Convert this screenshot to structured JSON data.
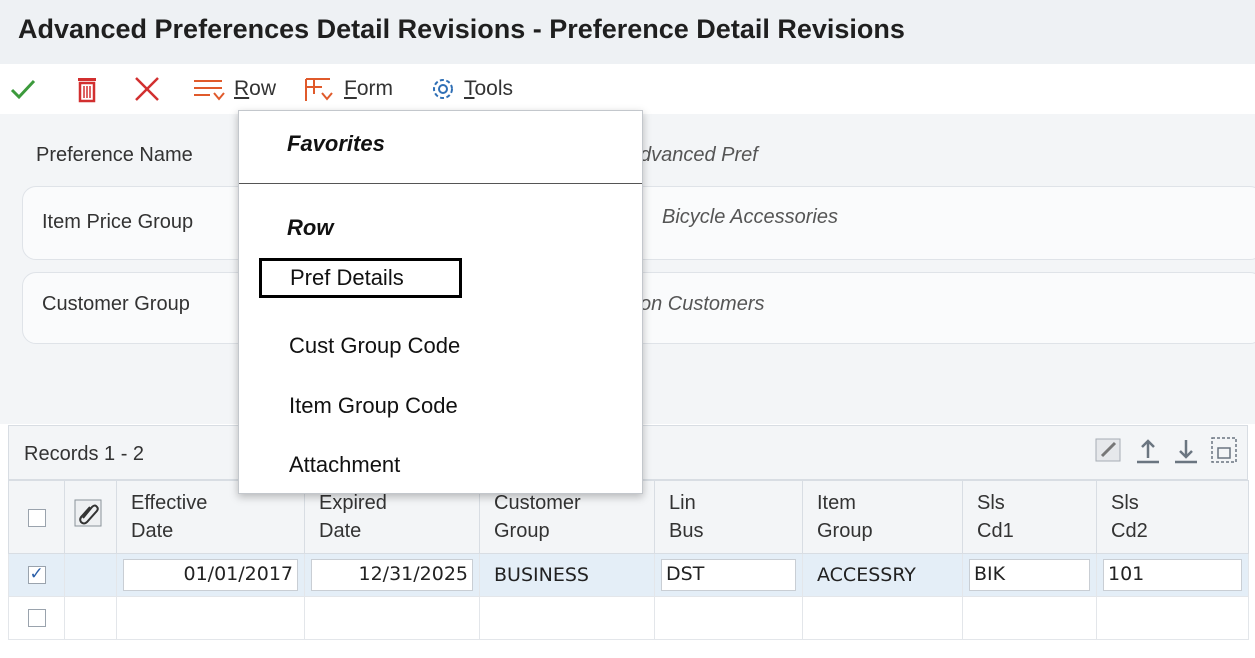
{
  "window": {
    "title": "Advanced Preferences Detail Revisions - Preference Detail Revisions"
  },
  "toolbar": {
    "ok_icon": "check-icon",
    "delete_icon": "trash-icon",
    "cancel_icon": "close-icon",
    "row_label_accel": "R",
    "row_label_rest": "ow",
    "form_label_accel": "F",
    "form_label_rest": "orm",
    "tools_label_accel": "T",
    "tools_label_rest": "ools"
  },
  "header": {
    "preference_name_label": "Preference Name",
    "preference_name_value": "dvanced Pref",
    "item_price_group_label": "Item Price Group",
    "item_price_group_value": "Bicycle Accessories",
    "customer_group_label": "Customer Group",
    "customer_group_value": "on Customers"
  },
  "grid": {
    "records_label": "Records 1 - 2",
    "columns": [
      {
        "line1": "Effective",
        "line2": "Date"
      },
      {
        "line1": "Expired",
        "line2": "Date"
      },
      {
        "line1": "Customer",
        "line2": "Group"
      },
      {
        "line1": "Lin",
        "line2": "Bus"
      },
      {
        "line1": "Item",
        "line2": "Group"
      },
      {
        "line1": "Sls",
        "line2": "Cd1"
      },
      {
        "line1": "Sls",
        "line2": "Cd2"
      }
    ],
    "rows": [
      {
        "checked": true,
        "effective_date": "01/01/2017",
        "expired_date": "12/31/2025",
        "customer_group": "BUSINESS",
        "lin_bus": "DST",
        "item_group": "ACCESSRY",
        "sls_cd1": "BIK",
        "sls_cd2": "101"
      },
      {
        "checked": false,
        "effective_date": "",
        "expired_date": "",
        "customer_group": "",
        "lin_bus": "",
        "item_group": "",
        "sls_cd1": "",
        "sls_cd2": ""
      }
    ]
  },
  "row_menu": {
    "favorites_heading": "Favorites",
    "row_heading": "Row",
    "items": [
      "Pref Details",
      "Cust Group Code",
      "Item Group Code",
      "Attachment"
    ]
  },
  "colors": {
    "ok_green": "#3c9a3c",
    "cancel_red": "#d22f2f",
    "menu_orange": "#e05a2b",
    "tools_blue": "#2f6fb5",
    "selected_row": "#e4eef7"
  }
}
